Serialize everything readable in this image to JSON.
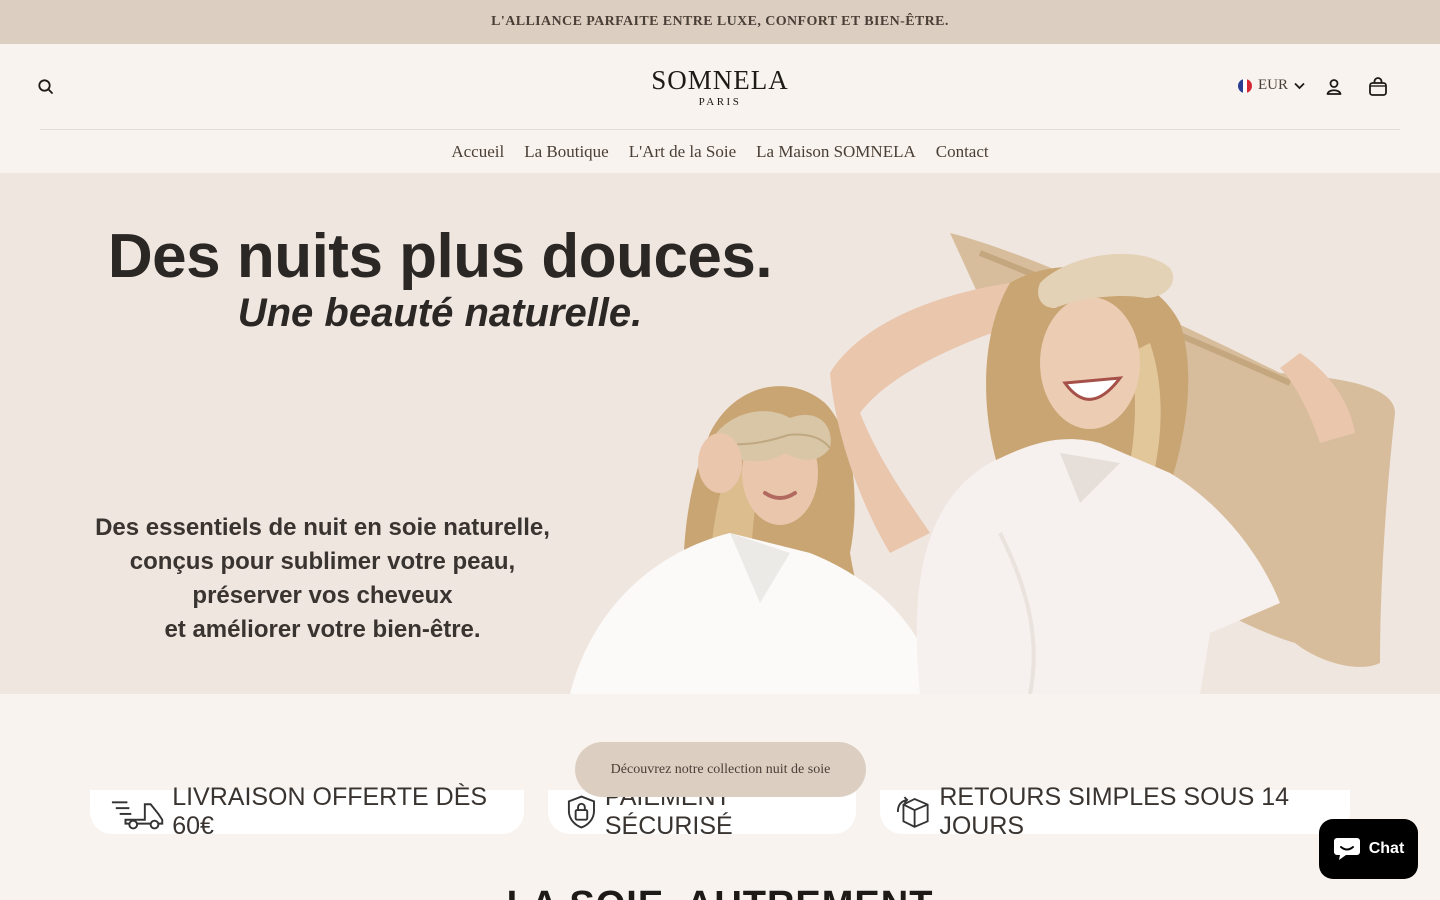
{
  "announcement": {
    "text": "L'ALLIANCE PARFAITE ENTRE LUXE, CONFORT ET BIEN-ÊTRE."
  },
  "header": {
    "logo_main": "SOMNELA",
    "logo_sub": "PARIS",
    "currency": "EUR",
    "icons": {
      "search": "search-icon",
      "account": "user-icon",
      "cart": "shopping-bag-icon",
      "flag": "france-flag-icon"
    }
  },
  "nav": {
    "items": [
      {
        "label": "Accueil"
      },
      {
        "label": "La Boutique"
      },
      {
        "label": "L'Art de la Soie"
      },
      {
        "label": "La Maison SOMNELA"
      },
      {
        "label": "Contact"
      }
    ]
  },
  "hero": {
    "title": "Des nuits plus douces.",
    "subtitle": "Une beauté naturelle.",
    "text_lines": [
      "Des essentiels de nuit en soie naturelle,",
      "conçus pour sublimer votre peau,",
      "préserver vos cheveux",
      "et améliorer votre bien-être."
    ]
  },
  "cta": {
    "label": "Découvrez notre collection nuit de soie"
  },
  "features": [
    {
      "label": "LIVRAISON OFFERTE DÈS 60€",
      "icon": "delivery-truck-icon"
    },
    {
      "label": "PAIEMENT SÉCURISÉ",
      "icon": "secure-shield-icon"
    },
    {
      "label": "RETOURS SIMPLES SOUS 14 JOURS",
      "icon": "return-box-icon"
    }
  ],
  "next_section": {
    "heading": "LA SOIE, AUTREMENT"
  },
  "chat": {
    "label": "Chat",
    "icon": "chat-bubble-icon"
  },
  "colors": {
    "announcement_bg": "#dccfc2",
    "page_bg": "#f8f3ee",
    "hero_bg": "#f0e6e0",
    "button_bg": "#dccfc2",
    "chat_bg": "#000000"
  }
}
